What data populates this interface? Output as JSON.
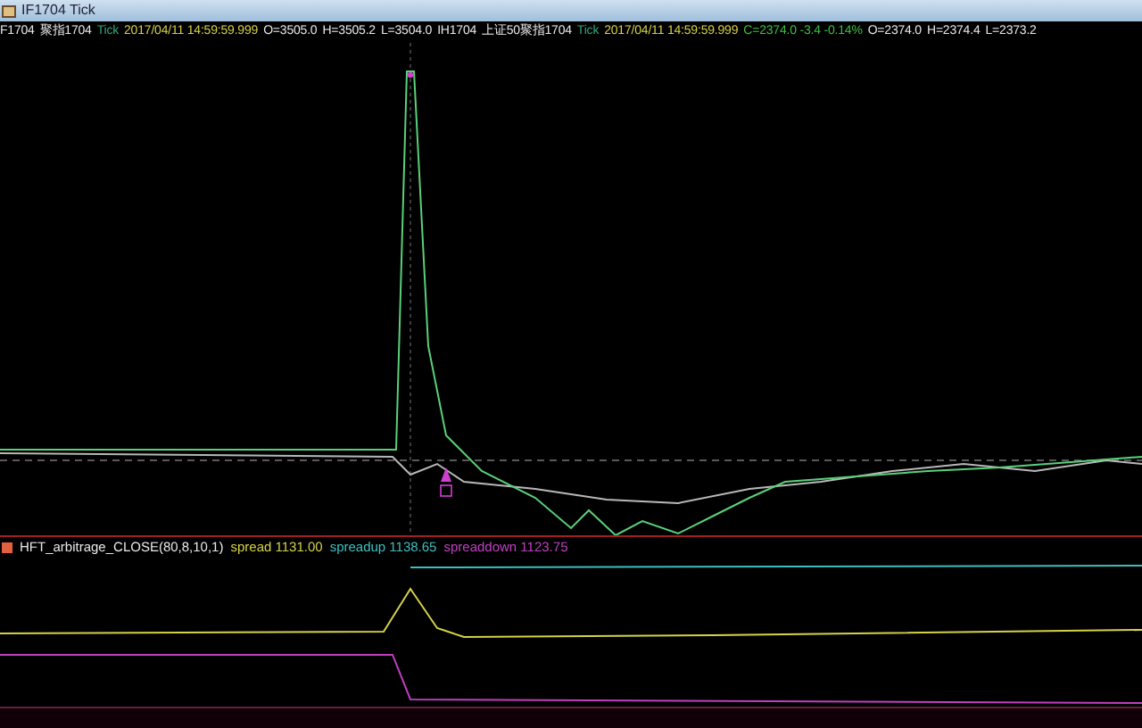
{
  "window": {
    "title": "IF1704 Tick"
  },
  "quote_line": [
    {
      "text": "F1704",
      "color": "#e8e8e8"
    },
    {
      "text": "聚指1704",
      "color": "#e8e8e8"
    },
    {
      "text": "Tick",
      "color": "#2fa37a"
    },
    {
      "text": "2017/04/11 14:59:59.999",
      "color": "#d6d24a"
    },
    {
      "text": "O=3505.0",
      "color": "#e8e8e8"
    },
    {
      "text": "H=3505.2",
      "color": "#e8e8e8"
    },
    {
      "text": "L=3504.0",
      "color": "#e8e8e8"
    },
    {
      "text": "IH1704",
      "color": "#e8e8e8"
    },
    {
      "text": "上证50聚指1704",
      "color": "#e8e8e8"
    },
    {
      "text": "Tick",
      "color": "#2fa37a"
    },
    {
      "text": "2017/04/11 14:59:59.999",
      "color": "#d6d24a"
    },
    {
      "text": "C=2374.0 -3.4 -0.14%",
      "color": "#3fbf3f"
    },
    {
      "text": "O=2374.0",
      "color": "#e8e8e8"
    },
    {
      "text": "H=2374.4",
      "color": "#e8e8e8"
    },
    {
      "text": "L=2373.2",
      "color": "#e8e8e8"
    }
  ],
  "indicator_line": [
    {
      "text": "HFT_arbitrage_CLOSE(80,8,10,1)",
      "color": "#e8e8e8"
    },
    {
      "text": "spread 1131.00",
      "color": "#d6d24a"
    },
    {
      "text": "spreadup 1138.65",
      "color": "#3fbfbf"
    },
    {
      "text": "spreaddown 1123.75",
      "color": "#c040c0"
    }
  ]
}
